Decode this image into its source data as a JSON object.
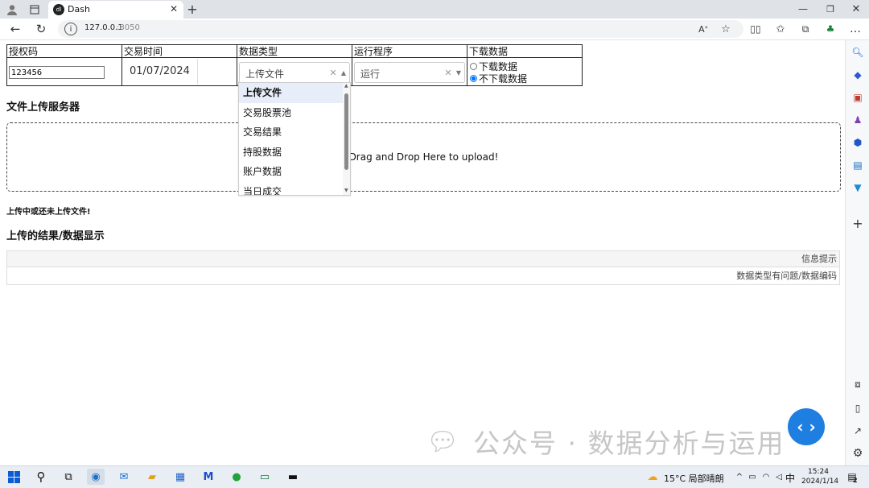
{
  "browser": {
    "tab_title": "Dash",
    "url_host": "127.0.0.1",
    "url_port": ":8050"
  },
  "controls": {
    "headers": [
      "授权码",
      "交易时间",
      "数据类型",
      "运行程序",
      "下载数据"
    ],
    "auth_code_value": "123456",
    "date_value": "01/07/2024",
    "data_type_selected": "上传文件",
    "run_program_selected": "运行",
    "download_options": [
      "下载数据",
      "不下载数据"
    ],
    "download_selected_index": 1
  },
  "dropdown_options": [
    "上传文件",
    "交易股票池",
    "交易结果",
    "持股数据",
    "账户数据",
    "当日成交"
  ],
  "upload": {
    "section_title": "文件上传服务器",
    "drop_text": "Drag and Drop Here to upload!",
    "status": "上传中或还未上传文件!"
  },
  "results": {
    "section_title": "上传的结果/数据显示",
    "table_header": "信息提示",
    "table_row": "数据类型有问题/数据编码"
  },
  "watermark": "公众号 · 数据分析与运用",
  "taskbar": {
    "weather": "15°C 局部晴朗",
    "time": "15:24",
    "date": "2024/1/14",
    "ime": "中",
    "notif_count": "2"
  },
  "icons": [
    "profile-icon",
    "tab-icon",
    "dash-logo-icon",
    "close-icon",
    "plus-icon",
    "back-icon",
    "reload-icon",
    "info-icon",
    "read-aloud-icon",
    "favorite-icon",
    "split-icon",
    "favorites-icon",
    "collections-icon",
    "extension-icon",
    "more-icon",
    "minimize-icon",
    "maximize-icon",
    "window-close-icon",
    "search-icon",
    "windows-icon"
  ]
}
